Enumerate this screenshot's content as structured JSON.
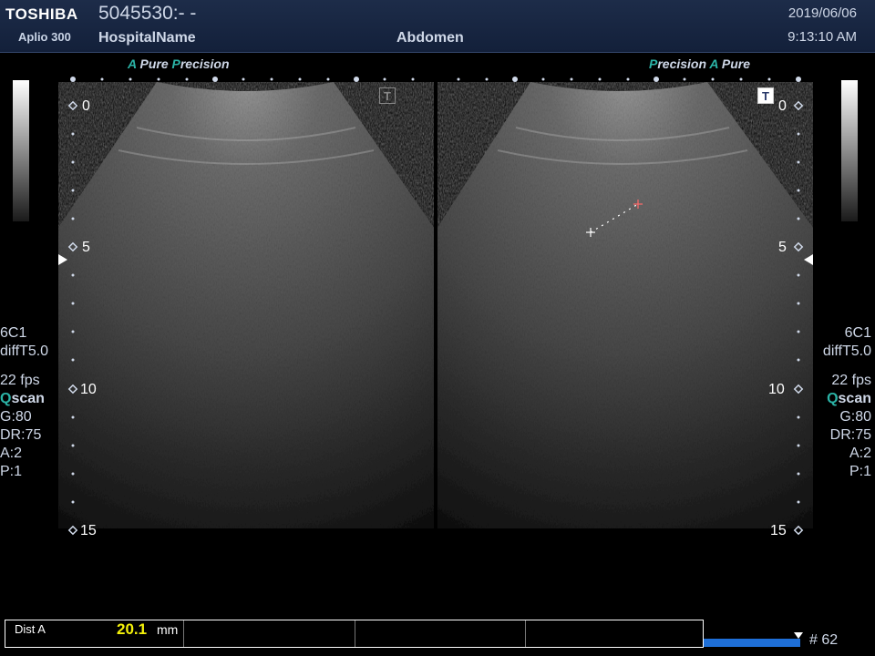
{
  "header": {
    "brand": "TOSHIBA",
    "model": "Aplio 300",
    "patient_id": "5045530:- -",
    "hospital": "HospitalName",
    "exam": "Abdomen",
    "date": "2019/06/06",
    "time": "9:13:10 AM"
  },
  "left_panel": {
    "logo_a": "A",
    "logo_pure": "Pure",
    "logo_p": "P",
    "logo_precision": "recision",
    "trans_icon": "T",
    "params": [
      "6C1",
      "diffT5.0",
      "22 fps",
      "",
      "G:80",
      "DR:75",
      "A:2",
      "P:1"
    ],
    "qscan_q": "Q",
    "qscan_rest": "scan",
    "depth_labels": [
      "0",
      "5",
      "10",
      "15"
    ]
  },
  "right_panel": {
    "logo_p": "P",
    "logo_precision": "recision",
    "logo_a": "A",
    "logo_pure": "Pure",
    "trans_icon": "T",
    "params": [
      "6C1",
      "diffT5.0",
      "22 fps",
      "",
      "G:80",
      "DR:75",
      "A:2",
      "P:1"
    ],
    "qscan_q": "Q",
    "qscan_rest": "scan",
    "depth_labels": [
      "0",
      "5",
      "10",
      "15"
    ]
  },
  "measurement": {
    "label": "Dist A",
    "value": "20.1",
    "unit": "mm"
  },
  "footer": {
    "frame": "# 62"
  },
  "icons": {
    "depth-marker": "diamond-icon",
    "focus": "focus-triangle-icon",
    "caliper": "caliper-cross-icon"
  }
}
